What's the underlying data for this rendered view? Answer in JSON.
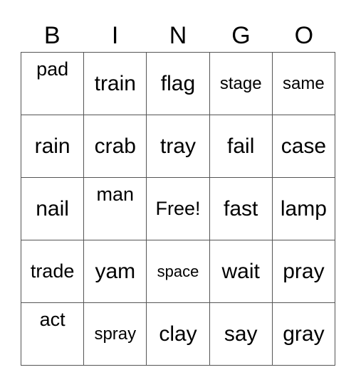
{
  "header": [
    "B",
    "I",
    "N",
    "G",
    "O"
  ],
  "cells": [
    [
      {
        "text": "pad",
        "pos": "top",
        "size": "s-m"
      },
      {
        "text": "train",
        "pos": "mid",
        "size": "s-l"
      },
      {
        "text": "flag",
        "pos": "mid",
        "size": "s-l"
      },
      {
        "text": "stage",
        "pos": "mid",
        "size": "s-s"
      },
      {
        "text": "same",
        "pos": "mid",
        "size": "s-s"
      }
    ],
    [
      {
        "text": "rain",
        "pos": "mid",
        "size": "s-l"
      },
      {
        "text": "crab",
        "pos": "mid",
        "size": "s-l"
      },
      {
        "text": "tray",
        "pos": "mid",
        "size": "s-l"
      },
      {
        "text": "fail",
        "pos": "mid",
        "size": "s-l"
      },
      {
        "text": "case",
        "pos": "mid",
        "size": "s-l"
      }
    ],
    [
      {
        "text": "nail",
        "pos": "mid",
        "size": "s-l"
      },
      {
        "text": "man",
        "pos": "top",
        "size": "s-m"
      },
      {
        "text": "Free!",
        "pos": "mid",
        "size": "s-m"
      },
      {
        "text": "fast",
        "pos": "mid",
        "size": "s-l"
      },
      {
        "text": "lamp",
        "pos": "mid",
        "size": "s-l"
      }
    ],
    [
      {
        "text": "trade",
        "pos": "mid",
        "size": "s-m"
      },
      {
        "text": "yam",
        "pos": "mid",
        "size": "s-l"
      },
      {
        "text": "space",
        "pos": "mid",
        "size": "s-xs"
      },
      {
        "text": "wait",
        "pos": "mid",
        "size": "s-l"
      },
      {
        "text": "pray",
        "pos": "mid",
        "size": "s-l"
      }
    ],
    [
      {
        "text": "act",
        "pos": "top",
        "size": "s-m"
      },
      {
        "text": "spray",
        "pos": "mid",
        "size": "s-s"
      },
      {
        "text": "clay",
        "pos": "mid",
        "size": "s-l"
      },
      {
        "text": "say",
        "pos": "mid",
        "size": "s-l"
      },
      {
        "text": "gray",
        "pos": "mid",
        "size": "s-l"
      }
    ]
  ]
}
